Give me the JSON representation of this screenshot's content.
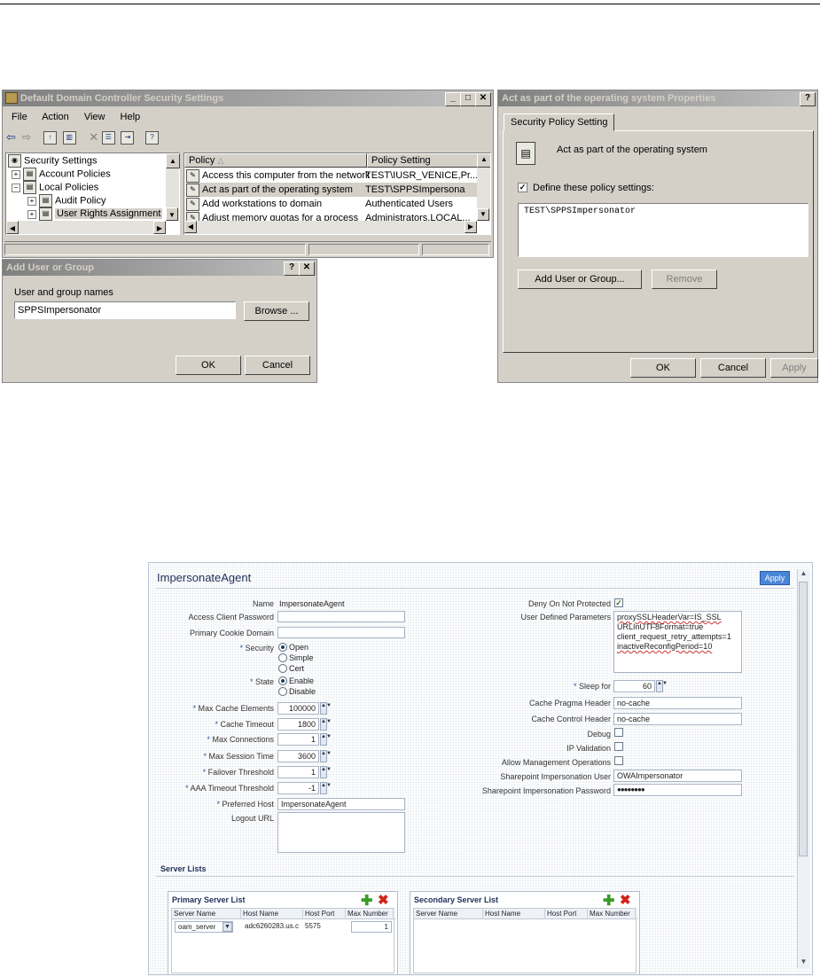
{
  "ddcs": {
    "title": "Default Domain Controller Security Settings",
    "menu": [
      "File",
      "Action",
      "View",
      "Help"
    ],
    "tree": [
      {
        "label": "Security Settings"
      },
      {
        "label": "Account Policies"
      },
      {
        "label": "Local Policies"
      },
      {
        "label": "Audit Policy"
      },
      {
        "label": "User Rights Assignment"
      }
    ],
    "list_headers": [
      "Policy",
      "Policy Setting"
    ],
    "rows": [
      {
        "policy": "Access this computer from the network",
        "setting": "TEST\\IUSR_VENICE,Pr..."
      },
      {
        "policy": "Act as part of the operating system",
        "setting": "TEST\\SPPSImpersona"
      },
      {
        "policy": "Add workstations to domain",
        "setting": "Authenticated Users"
      },
      {
        "policy": "Adjust memory quotas for a process",
        "setting": "Administrators,LOCAL..."
      }
    ]
  },
  "add_user": {
    "title": "Add User or Group",
    "field_label": "User and group names",
    "value": "SPPSImpersonator",
    "browse": "Browse ...",
    "ok": "OK",
    "cancel": "Cancel"
  },
  "props": {
    "title": "Act as part of the operating system Properties",
    "tab": "Security Policy Setting",
    "policy_name": "Act as part of the operating system",
    "define_label": "Define these policy settings:",
    "entry": "TEST\\SPPSImpersonator",
    "add_btn": "Add User or Group...",
    "remove_btn": "Remove",
    "ok": "OK",
    "cancel": "Cancel",
    "apply": "Apply"
  },
  "agent": {
    "title": "ImpersonateAgent",
    "apply": "Apply",
    "left": {
      "name_label": "Name",
      "name_value": "ImpersonateAgent",
      "acp_label": "Access Client Password",
      "pcd_label": "Primary Cookie Domain",
      "security_label": "Security",
      "security_options": [
        "Open",
        "Simple",
        "Cert"
      ],
      "state_label": "State",
      "state_options": [
        "Enable",
        "Disable"
      ],
      "mce_label": "Max Cache Elements",
      "mce_value": "100000",
      "ct_label": "Cache Timeout",
      "ct_value": "1800",
      "mc_label": "Max Connections",
      "mc_value": "1",
      "mst_label": "Max Session Time",
      "mst_value": "3600",
      "ft_label": "Failover Threshold",
      "ft_value": "1",
      "aaa_label": "AAA Timeout Threshold",
      "aaa_value": "-1",
      "ph_label": "Preferred Host",
      "ph_value": "ImpersonateAgent",
      "logout_label": "Logout URL"
    },
    "right": {
      "dnp_label": "Deny On Not Protected",
      "udp_label": "User Defined Parameters",
      "udp_lines": [
        "proxySSLHeaderVar=IS_SSL",
        "URLInUTF8Format=true",
        "client_request_retry_attempts=1",
        "inactiveReconfigPeriod=10"
      ],
      "sleep_label": "Sleep for",
      "sleep_value": "60",
      "cph_label": "Cache Pragma Header",
      "cph_value": "no-cache",
      "cch_label": "Cache Control Header",
      "cch_value": "no-cache",
      "debug_label": "Debug",
      "ipv_label": "IP Validation",
      "amo_label": "Allow Management Operations",
      "siu_label": "Sharepoint Impersonation User",
      "siu_value": "OWAImpersonator",
      "sip_label": "Sharepoint Impersonation Password",
      "sip_value": "●●●●●●●●"
    },
    "server_lists": "Server Lists",
    "primary": {
      "title": "Primary Server List",
      "headers": [
        "Server Name",
        "Host Name",
        "Host Port",
        "Max Number"
      ],
      "row": {
        "server": "oam_server",
        "host": "adc6260283.us.c",
        "port": "5575",
        "max": "1"
      }
    },
    "secondary": {
      "title": "Secondary Server List",
      "headers": [
        "Server Name",
        "Host Name",
        "Host Port",
        "Max Number"
      ]
    }
  }
}
